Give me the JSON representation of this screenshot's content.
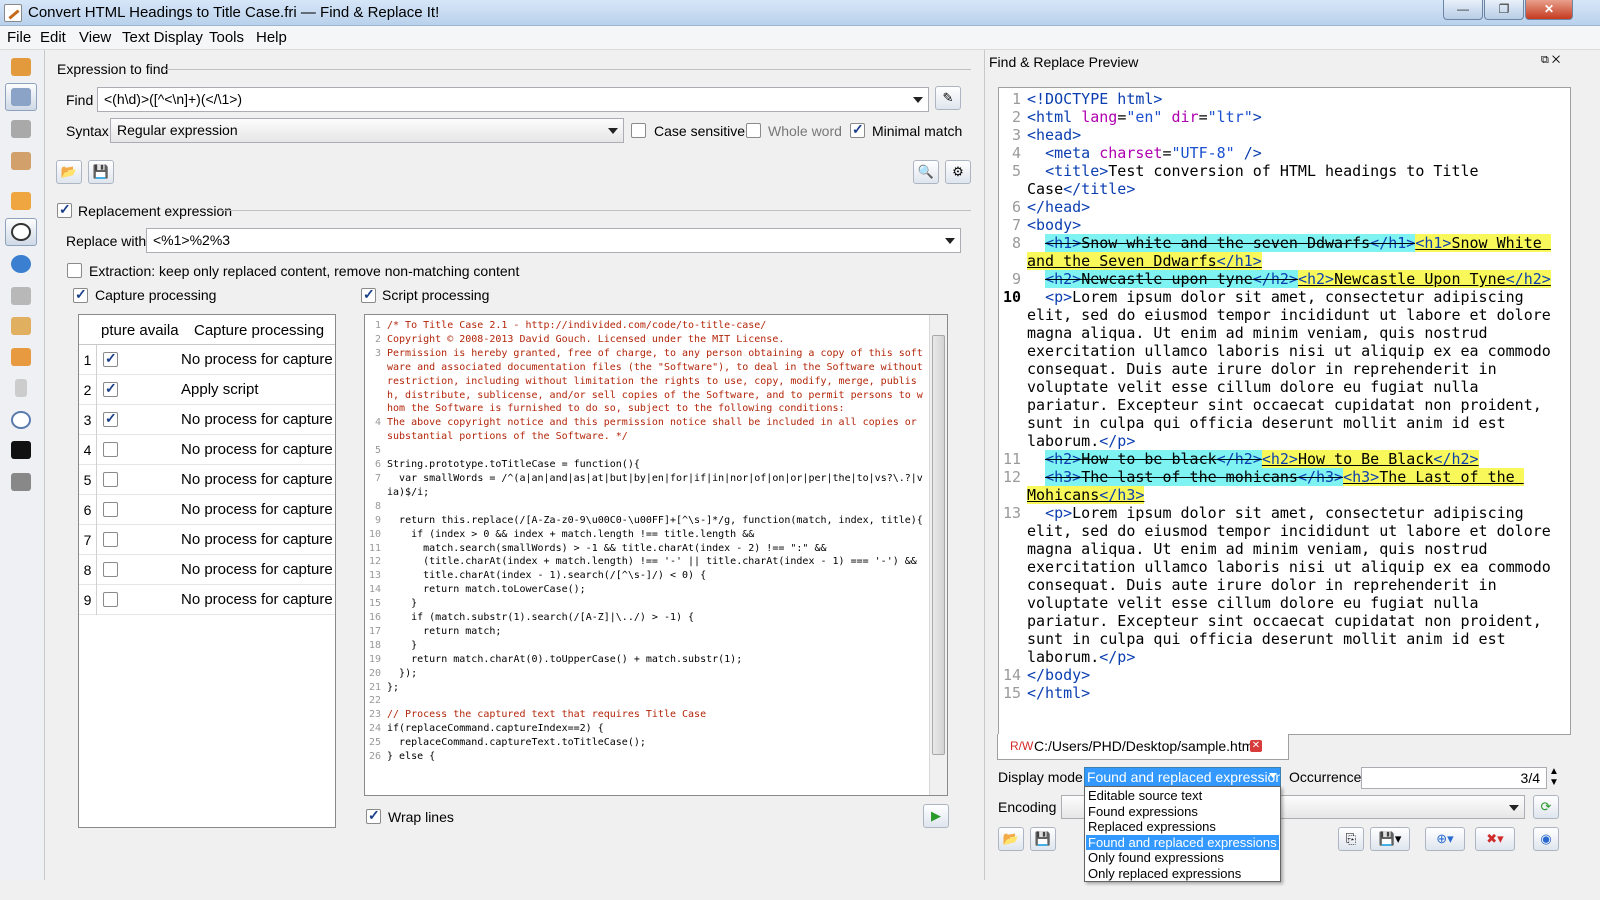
{
  "window": {
    "title": "Convert HTML Headings to Title Case.fri — Find & Replace It!",
    "minimize": "—",
    "restore": "❐",
    "close": "✕"
  },
  "menu": [
    "File",
    "Edit",
    "View",
    "Text Display",
    "Tools",
    "Help"
  ],
  "find_section": {
    "group_label": "Expression to find",
    "find_label": "Find",
    "find_value": "<(h\\d)>([^<\\n]+)(</\\1>)",
    "syntax_label": "Syntax",
    "syntax_value": "Regular expression",
    "case_sensitive": "Case sensitive",
    "whole_word": "Whole word",
    "minimal_match": "Minimal match"
  },
  "replace_section": {
    "group_label": "Replacement expression",
    "replace_label": "Replace with",
    "replace_value": "<%1>%2%3",
    "extraction_label": "Extraction: keep only replaced content, remove non-matching content"
  },
  "capture": {
    "group_label": "Capture processing",
    "col1": "pture availa",
    "col2": "Capture processing",
    "rows": [
      {
        "num": "1",
        "checked": true,
        "value": "No process for capture"
      },
      {
        "num": "2",
        "checked": true,
        "value": "Apply script"
      },
      {
        "num": "3",
        "checked": true,
        "value": "No process for capture"
      },
      {
        "num": "4",
        "checked": false,
        "value": "No process for capture"
      },
      {
        "num": "5",
        "checked": false,
        "value": "No process for capture"
      },
      {
        "num": "6",
        "checked": false,
        "value": "No process for capture"
      },
      {
        "num": "7",
        "checked": false,
        "value": "No process for capture"
      },
      {
        "num": "8",
        "checked": false,
        "value": "No process for capture"
      },
      {
        "num": "9",
        "checked": false,
        "value": "No process for capture"
      }
    ]
  },
  "script": {
    "group_label": "Script processing",
    "wrap_lines": "Wrap lines",
    "lines": [
      {
        "n": "1",
        "t": "/* To Title Case 2.1 - http://individed.com/code/to-title-case/",
        "c": true
      },
      {
        "n": "2",
        "t": "Copyright © 2008-2013 David Gouch. Licensed under the MIT License.",
        "c": true
      },
      {
        "n": "3",
        "t": "Permission is hereby granted, free of charge, to any person obtaining a copy of this software and associated documentation files (the \"Software\"), to deal in the Software without restriction, including without limitation the rights to use, copy, modify, merge, publish, distribute, sublicense, and/or sell copies of the Software, and to permit persons to whom the Software is furnished to do so, subject to the following conditions:",
        "c": true
      },
      {
        "n": "4",
        "t": "The above copyright notice and this permission notice shall be included in all copies or substantial portions of the Software. */",
        "c": true
      },
      {
        "n": "5",
        "t": " ",
        "c": false
      },
      {
        "n": "6",
        "t": "String.prototype.toTitleCase = function(){",
        "c": false
      },
      {
        "n": "7",
        "t": "  var smallWords = /^(a|an|and|as|at|but|by|en|for|if|in|nor|of|on|or|per|the|to|vs?\\.?|via)$/i;",
        "c": false
      },
      {
        "n": "8",
        "t": " ",
        "c": false
      },
      {
        "n": "9",
        "t": "  return this.replace(/[A-Za-z0-9\\u00C0-\\u00FF]+[^\\s-]*/g, function(match, index, title){",
        "c": false
      },
      {
        "n": "10",
        "t": "    if (index > 0 && index + match.length !== title.length &&",
        "c": false
      },
      {
        "n": "11",
        "t": "      match.search(smallWords) > -1 && title.charAt(index - 2) !== \":\" &&",
        "c": false
      },
      {
        "n": "12",
        "t": "      (title.charAt(index + match.length) !== '-' || title.charAt(index - 1) === '-') &&",
        "c": false
      },
      {
        "n": "13",
        "t": "      title.charAt(index - 1).search(/[^\\s-]/) < 0) {",
        "c": false
      },
      {
        "n": "14",
        "t": "      return match.toLowerCase();",
        "c": false
      },
      {
        "n": "15",
        "t": "    }",
        "c": false
      },
      {
        "n": "16",
        "t": "    if (match.substr(1).search(/[A-Z]|\\../) > -1) {",
        "c": false
      },
      {
        "n": "17",
        "t": "      return match;",
        "c": false
      },
      {
        "n": "18",
        "t": "    }",
        "c": false
      },
      {
        "n": "19",
        "t": "    return match.charAt(0).toUpperCase() + match.substr(1);",
        "c": false
      },
      {
        "n": "20",
        "t": "  });",
        "c": false
      },
      {
        "n": "21",
        "t": "};",
        "c": false
      },
      {
        "n": "22",
        "t": " ",
        "c": false
      },
      {
        "n": "23",
        "t": "// Process the captured text that requires Title Case",
        "c": true
      },
      {
        "n": "24",
        "t": "if(replaceCommand.captureIndex==2) {",
        "c": false
      },
      {
        "n": "25",
        "t": "  replaceCommand.captureText.toTitleCase();",
        "c": false
      },
      {
        "n": "26",
        "t": "} else {",
        "c": false
      }
    ]
  },
  "preview": {
    "title": "Find & Replace Preview",
    "path_prefix": "R/W",
    "path": "C:/Users/PHD/Desktop/sample.html",
    "display_mode_label": "Display mode",
    "display_mode_value": "Found and replaced expression",
    "occurrence_label": "Occurrence",
    "occurrence_value": "3/4",
    "encoding_label": "Encoding",
    "dropdown_options": [
      "Editable source text",
      "Found expressions",
      "Replaced expressions",
      "Found and replaced expressions",
      "Only found expressions",
      "Only replaced expressions"
    ],
    "dropdown_selected": 3,
    "lorem": "Lorem ipsum dolor sit amet, consectetur adipiscing elit, sed do eiusmod tempor incididunt ut labore et dolore magna aliqua. Ut enim ad minim veniam, quis nostrud exercitation ullamco laboris nisi ut aliquip ex ea commodo consequat. Duis aute irure dolor in reprehenderit in voluptate velit esse cillum dolore eu fugiat nulla pariatur. Excepteur sint occaecat cupidatat non proident, sunt in culpa qui officia deserunt mollit anim id est laborum."
  },
  "colors": {
    "found_bg": "#7ff2f2",
    "replaced_bg": "#f8f85a",
    "selection": "#3399ff",
    "tag": "#0b3fb0",
    "comment": "#b3260a"
  },
  "icons": {
    "sidebar": [
      "find-icon",
      "replace-icon",
      "tools-icon",
      "edit-icon",
      "folder-icon",
      "preview-icon",
      "browser-icon",
      "scissors-icon",
      "document-icon",
      "folder2-icon",
      "bottle-icon",
      "magnifier-icon",
      "console-icon",
      "printer-icon"
    ]
  }
}
